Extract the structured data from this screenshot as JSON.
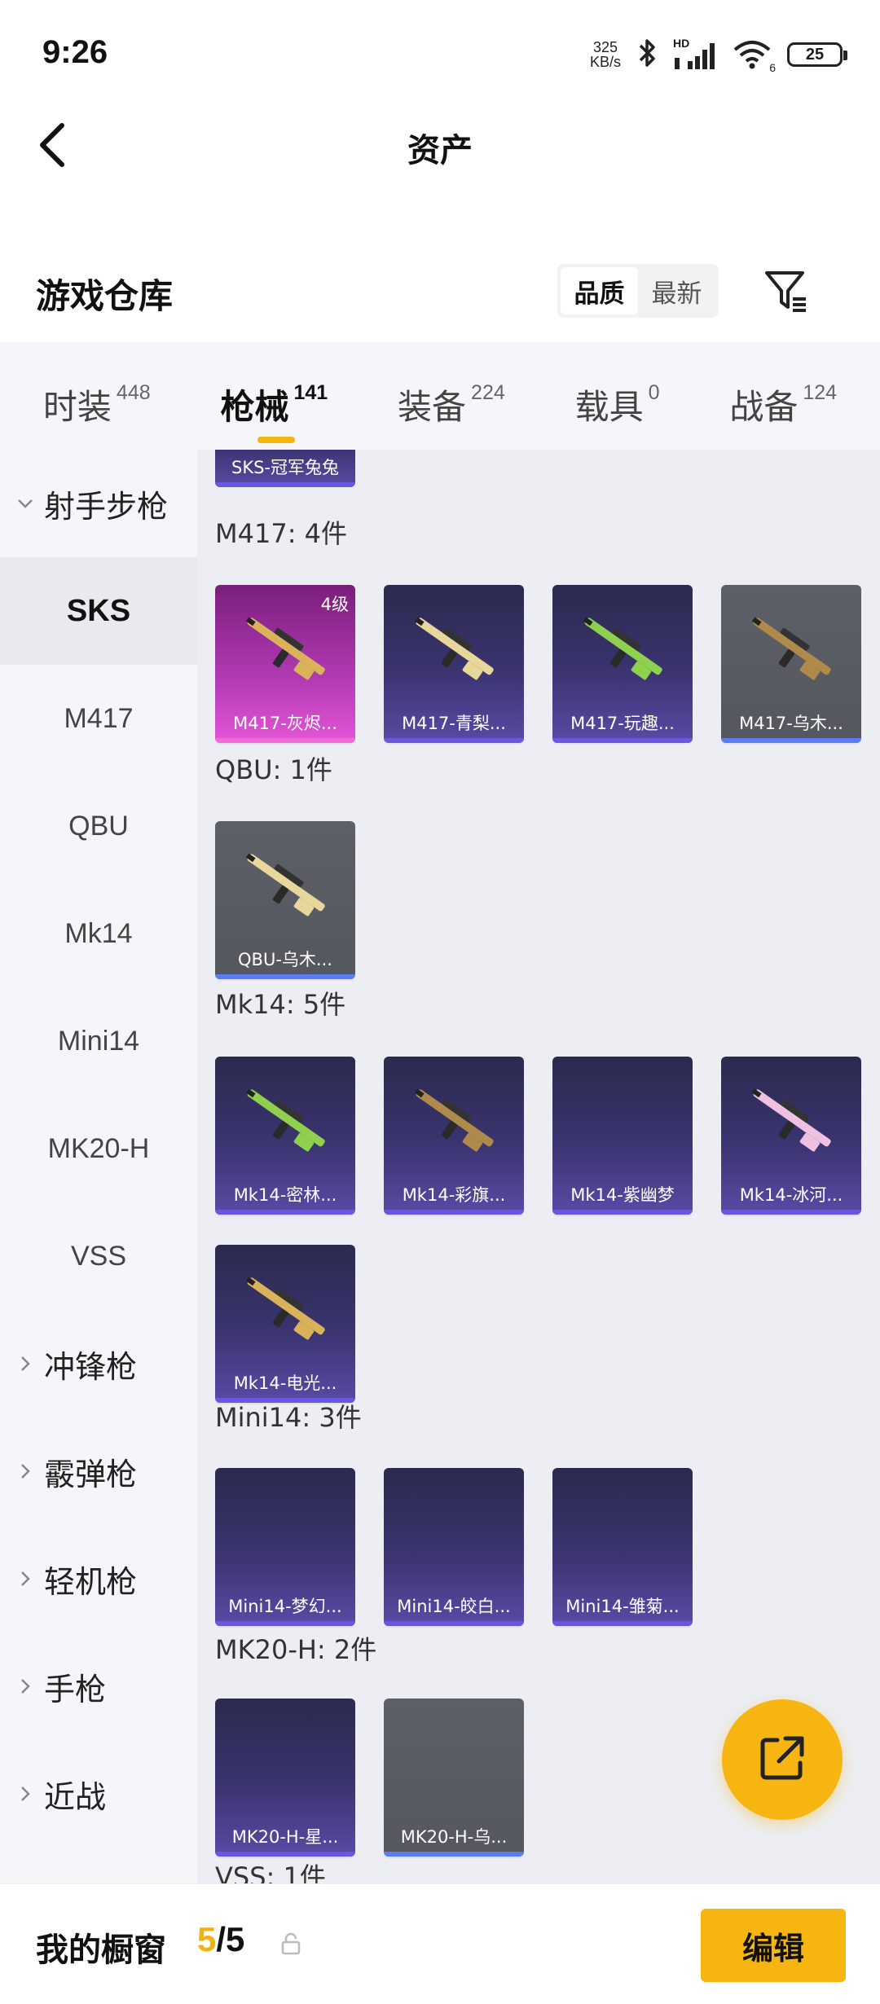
{
  "status_bar": {
    "time": "9:26",
    "net_speed_value": "325",
    "net_speed_unit": "KB/s",
    "network_label": "HD",
    "wifi_label": "6",
    "battery": "25"
  },
  "nav": {
    "title": "资产"
  },
  "warehouse": {
    "title": "游戏仓库",
    "sort_options": [
      "品质",
      "最新"
    ],
    "active_sort": "品质"
  },
  "tabs": [
    {
      "label": "时装",
      "count": "448"
    },
    {
      "label": "枪械",
      "count": "141"
    },
    {
      "label": "装备",
      "count": "224"
    },
    {
      "label": "载具",
      "count": "0"
    },
    {
      "label": "战备",
      "count": "124"
    }
  ],
  "sidebar": {
    "group_open": "射手步枪",
    "items": [
      "SKS",
      "M417",
      "QBU",
      "Mk14",
      "Mini14",
      "MK20-H",
      "VSS"
    ],
    "groups_closed": [
      "冲锋枪",
      "霰弹枪",
      "轻机枪",
      "手枪",
      "近战"
    ]
  },
  "content": {
    "top_partial_card": "SKS-冠军兔兔",
    "sections": [
      {
        "title": "M417: 4件",
        "cards": [
          {
            "label": "M417-灰烬...",
            "level": "4级",
            "style": "pink"
          },
          {
            "label": "M417-青梨...",
            "style": "purple"
          },
          {
            "label": "M417-玩趣...",
            "style": "purple"
          },
          {
            "label": "M417-乌木...",
            "style": "gray"
          }
        ]
      },
      {
        "title": "QBU: 1件",
        "cards": [
          {
            "label": "QBU-乌木...",
            "style": "gray"
          }
        ]
      },
      {
        "title": "Mk14: 5件",
        "cards": [
          {
            "label": "Mk14-密林...",
            "style": "purple"
          },
          {
            "label": "Mk14-彩旗...",
            "style": "purple"
          },
          {
            "label": "Mk14-紫幽梦",
            "style": "purple"
          },
          {
            "label": "Mk14-冰河...",
            "style": "purple"
          },
          {
            "label": "Mk14-电光...",
            "style": "purple"
          }
        ]
      },
      {
        "title": "Mini14: 3件",
        "cards": [
          {
            "label": "Mini14-梦幻...",
            "style": "purple"
          },
          {
            "label": "Mini14-皎白...",
            "style": "purple"
          },
          {
            "label": "Mini14-雏菊...",
            "style": "purple"
          }
        ]
      },
      {
        "title": "MK20-H: 2件",
        "cards": [
          {
            "label": "MK20-H-星...",
            "style": "purple"
          },
          {
            "label": "MK20-H-乌...",
            "style": "gray"
          }
        ]
      },
      {
        "title": "VSS: 1件",
        "cards": []
      }
    ]
  },
  "bottom": {
    "showcase_label": "我的橱窗",
    "showcase_current": "5",
    "showcase_separator": "/",
    "showcase_max": "5",
    "edit_label": "编辑"
  },
  "colors": {
    "accent": "#f7b512",
    "card_purple": "#3a3470",
    "card_gray": "#5d6068",
    "card_pink": "#b23bb5"
  }
}
